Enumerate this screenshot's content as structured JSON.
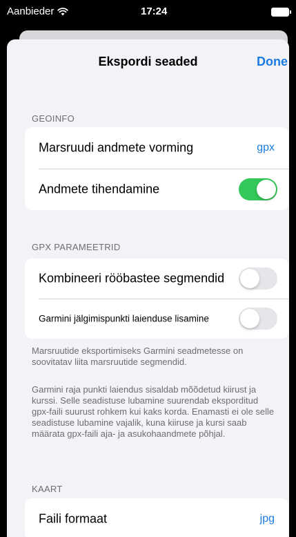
{
  "status_bar": {
    "carrier": "Aanbieder",
    "time": "17:24",
    "wifi_icon": "wifi-icon",
    "battery_icon": "battery-icon"
  },
  "nav": {
    "title": "Ekspordi seaded",
    "done_label": "Done"
  },
  "sections": {
    "geoinfo": {
      "header": "GEOINFO",
      "route_format_label": "Marsruudi andmete vorming",
      "route_format_value": "gpx",
      "compression_label": "Andmete tihendamine",
      "compression_on": true
    },
    "gpx": {
      "header": "GPX PARAMEETRID",
      "combine_label": "Kombineeri rööbastee segmendid",
      "combine_on": false,
      "garmin_label": "Garmini jälgimispunkti laienduse lisamine",
      "garmin_on": false,
      "footnote_1": "Marsruutide eksportimiseks Garmini seadmetesse on soovitatav liita marsruutide segmendid.",
      "footnote_2": "Garmini raja punkti laiendus sisaldab mõõdetud kiirust ja kurssi. Selle seadistuse lubamine suurendab eksporditud gpx-faili suurust rohkem kui kaks korda. Enamasti ei ole selle seadistuse lubamine vajalik, kuna kiiruse ja kursi saab määrata gpx-faili aja- ja asukohaandmete põhjal."
    },
    "map": {
      "header": "KAART",
      "file_format_label": "Faili formaat",
      "file_format_value": "jpg"
    }
  },
  "colors": {
    "accent": "#1a7ae3",
    "toggle_on": "#34c759",
    "toggle_off": "#e5e5ea",
    "background": "#f2f2f7"
  }
}
